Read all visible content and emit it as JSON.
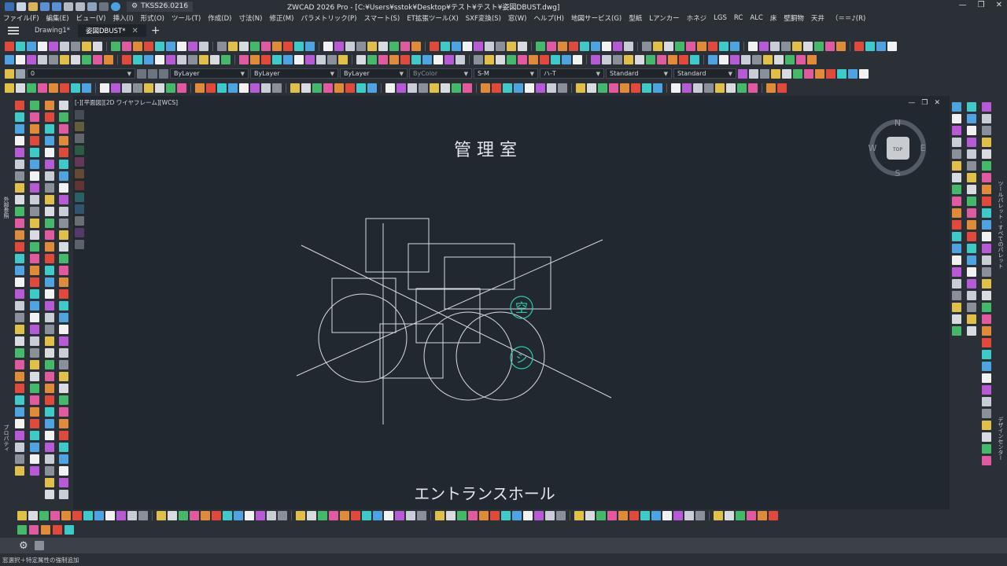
{
  "window": {
    "workspace": "TKSS26.0216",
    "title": "ZWCAD 2026 Pro - [C:¥Users¥sstok¥Desktop¥テスト¥テスト¥姿図DBUST.dwg]",
    "controls": [
      "—",
      "❐",
      "✕"
    ]
  },
  "menu": [
    "ファイル(F)",
    "編集(E)",
    "ビュー(V)",
    "挿入(I)",
    "形式(O)",
    "ツール(T)",
    "作成(D)",
    "寸法(N)",
    "修正(M)",
    "パラメトリック(P)",
    "スマート(S)",
    "ET拡張ツール(X)",
    "SXF変換(S)",
    "窓(W)",
    "ヘルプ(H)",
    "地図サービス(G)",
    "型紙",
    "Lアンカー",
    "ホネジ",
    "LGS",
    "RC",
    "ALC",
    "床",
    "壁胴物",
    "天井",
    "（＝＝♪(R)"
  ],
  "tabs": [
    {
      "label": "Drawing1*",
      "active": false
    },
    {
      "label": "姿図DBUST*",
      "active": true
    }
  ],
  "properties": {
    "layer": "0",
    "color": "ByLayer",
    "linetype": "ByLayer",
    "lineweight": "ByLayer",
    "plotstyle": "ByColor",
    "textstyle": "S-M",
    "dimstyle": "ハ-T",
    "tablestyle": "Standard",
    "mleaderstyle": "Standard"
  },
  "viewport": {
    "label": "[-][平面図][2D ワイヤフレーム][WCS]",
    "controls": [
      "—",
      "❐",
      "✕"
    ]
  },
  "drawing": {
    "room_title": "管 理 室",
    "entrance_label": "エントランスホール",
    "symbol_sky": "空",
    "symbol_shi": "シ",
    "colors": {
      "line": "#d8dce2",
      "symbol": "#34c9a4",
      "background": "#212830"
    }
  },
  "viewcube": {
    "top": "TOP",
    "n": "N",
    "s": "S",
    "e": "E",
    "w": "W"
  },
  "side_labels": {
    "left_top": "外部参照",
    "left_bottom": "プロパティ",
    "right_top": "ツールパレット - すべてのパレット",
    "right_bottom": "デザインセンター"
  },
  "statusbar": {
    "text": "窓選択＋特定属性の強制追加"
  }
}
